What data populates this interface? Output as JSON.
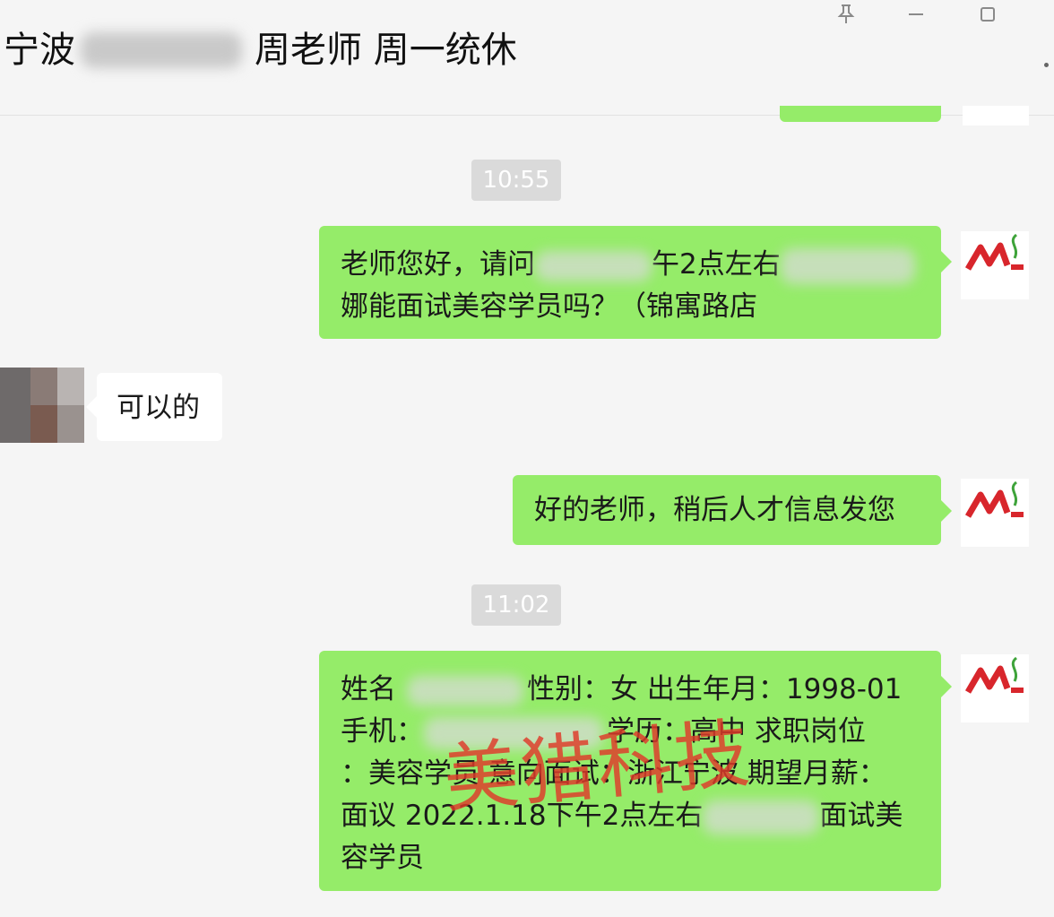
{
  "header": {
    "title_left": "宁波",
    "title_right": "周老师 周一统休",
    "pin_icon": "pin-icon",
    "minimize_icon": "minimize-icon",
    "maximize_icon": "maximize-icon"
  },
  "messages": {
    "time_1": "10:55",
    "msg1": {
      "line1": "老师您好，请问",
      "line1_tail": "午2点左右",
      "line2": "娜能面试美容学员吗？（锦寓路店"
    },
    "msg2": {
      "text": "可以的"
    },
    "msg3": {
      "text": "好的老师，稍后人才信息发您"
    },
    "time_2": "11:02",
    "msg4": {
      "line1_a": "姓名",
      "line1_b": "性别：女 出生年月：1998-01",
      "line2_a": " 手机：",
      "line2_b": "学历：高中 求职岗位",
      "line3": "：美容学员 意向面试：浙江宁波 期望月薪：",
      "line4_a": "面议 2022.1.18下午2点左右",
      "line4_b": "面试美",
      "line5": "容学员"
    }
  },
  "watermark": "美猎科技",
  "colors": {
    "bubble_me": "#95ec69",
    "bubble_other": "#ffffff",
    "background": "#f5f5f5",
    "time_badge": "#dadada",
    "logo_red": "#d8262c",
    "logo_green": "#3ea33a",
    "watermark": "#e03a2a"
  }
}
